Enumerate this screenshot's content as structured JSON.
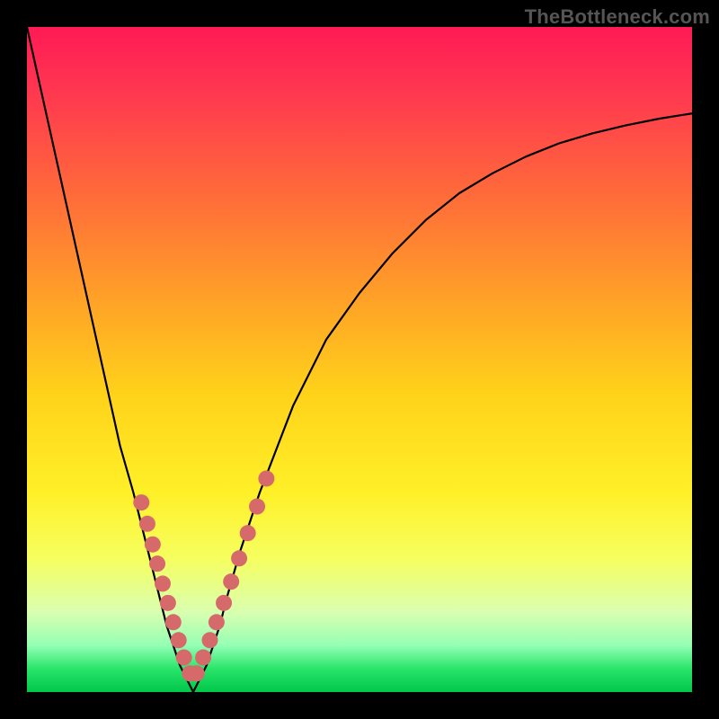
{
  "watermark": "TheBottleneck.com",
  "colors": {
    "frame": "#000000",
    "curve": "#000000",
    "marker_fill": "#d66a6a",
    "marker_stroke": "#b54f4f",
    "gradient_stops": [
      {
        "y": 0.0,
        "color": "#ff1a55"
      },
      {
        "y": 0.1,
        "color": "#ff3850"
      },
      {
        "y": 0.25,
        "color": "#ff6a3a"
      },
      {
        "y": 0.4,
        "color": "#ff9e28"
      },
      {
        "y": 0.55,
        "color": "#ffd21a"
      },
      {
        "y": 0.7,
        "color": "#fff028"
      },
      {
        "y": 0.8,
        "color": "#f6ff60"
      },
      {
        "y": 0.88,
        "color": "#d9ffb0"
      },
      {
        "y": 0.93,
        "color": "#94ffb4"
      },
      {
        "y": 0.965,
        "color": "#29e56a"
      },
      {
        "y": 1.0,
        "color": "#00c74a"
      }
    ]
  },
  "chart_data": {
    "type": "line",
    "title": "",
    "xlabel": "",
    "ylabel": "",
    "xlim": [
      0,
      100
    ],
    "ylim": [
      0,
      100
    ],
    "grid": false,
    "legend": false,
    "x_minimum": 25,
    "series": [
      {
        "name": "bottleneck-curve",
        "x": [
          0,
          2,
          4,
          6,
          8,
          10,
          12,
          14,
          16,
          18,
          20,
          21,
          22,
          23,
          24,
          24.5,
          25,
          25.5,
          26,
          27,
          28,
          29,
          30,
          32,
          35,
          40,
          45,
          50,
          55,
          60,
          65,
          70,
          75,
          80,
          85,
          90,
          95,
          100
        ],
        "y": [
          100,
          91,
          82,
          73,
          64,
          55,
          46,
          37,
          30,
          22,
          14,
          10,
          7,
          4,
          2,
          1,
          0,
          1,
          2,
          4,
          7,
          10,
          14,
          21,
          30,
          43,
          53,
          60,
          66,
          71,
          75,
          78,
          80.5,
          82.5,
          84,
          85.2,
          86.2,
          87
        ]
      }
    ],
    "markers": {
      "name": "gpu-points",
      "x": [
        17.2,
        18.1,
        18.9,
        19.6,
        20.4,
        21.2,
        22.0,
        22.8,
        23.6,
        24.5,
        25.5,
        26.5,
        27.5,
        28.5,
        29.6,
        30.7,
        31.9,
        33.2,
        34.6,
        36.0
      ],
      "y": [
        28.5,
        25.3,
        22.2,
        19.3,
        16.3,
        13.4,
        10.5,
        7.8,
        5.2,
        2.8,
        2.8,
        5.2,
        7.8,
        10.5,
        13.4,
        16.6,
        20.1,
        23.9,
        27.9,
        32.1
      ],
      "r": 9
    }
  }
}
